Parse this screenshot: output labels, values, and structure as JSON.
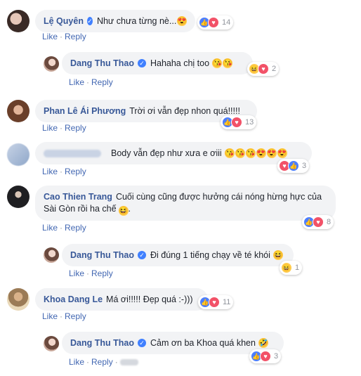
{
  "actions": {
    "like": "Like",
    "reply": "Reply"
  },
  "comments": [
    {
      "name": "Lệ Quyên",
      "verified": true,
      "text": "Như chưa từng nè...",
      "emojis": [
        "😍"
      ],
      "reactions": [
        "like",
        "love"
      ],
      "count": "14"
    },
    {
      "name": "Dang Thu Thao",
      "verified": true,
      "text": "Hahaha chị too",
      "emojis": [
        "😘",
        "😘"
      ],
      "reactions": [
        "haha",
        "love"
      ],
      "count": "2"
    },
    {
      "name": "Phan Lê Ái Phương",
      "verified": false,
      "text": "Trời ơi vẫn đẹp nhon quá!!!!!",
      "emojis": [],
      "reactions": [
        "like",
        "love"
      ],
      "count": "13"
    },
    {
      "name": "",
      "verified": false,
      "text": "Body vẫn đẹp như xưa e ơiii",
      "emojis": [
        "😘",
        "😘",
        "😘",
        "😍",
        "😍",
        "😍"
      ],
      "reactions": [
        "love",
        "like"
      ],
      "count": "3"
    },
    {
      "name": "Cao Thien Trang",
      "verified": false,
      "text": "Cuối cùng cũng được hưởng cái nóng hừng hực của Sài Gòn rồi ha chế",
      "emojis": [
        "😆"
      ],
      "reactions": [
        "like",
        "love"
      ],
      "count": "8"
    },
    {
      "name": "Dang Thu Thao",
      "verified": true,
      "text": "Đi đúng 1 tiếng chạy về té khói",
      "emojis": [
        "😆"
      ],
      "reactions": [
        "haha"
      ],
      "count": "1"
    },
    {
      "name": "Khoa Dang Le",
      "verified": false,
      "text": "Má ơi!!!!! Đẹp quá :-)))",
      "emojis": [],
      "reactions": [
        "like",
        "love"
      ],
      "count": "11"
    },
    {
      "name": "Dang Thu Thao",
      "verified": true,
      "text": "Cảm ơn ba Khoa quá khen",
      "emojis": [
        "🤣"
      ],
      "reactions": [
        "like",
        "love"
      ],
      "count": "3"
    }
  ]
}
